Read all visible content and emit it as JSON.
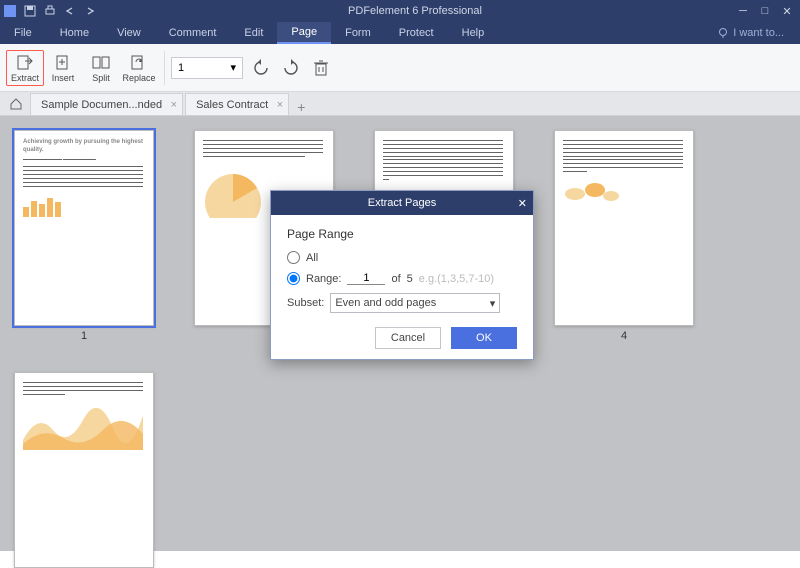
{
  "app": {
    "title": "PDFelement 6 Professional"
  },
  "menu": {
    "items": [
      "File",
      "Home",
      "View",
      "Comment",
      "Edit",
      "Page",
      "Form",
      "Protect",
      "Help"
    ],
    "active": "Page",
    "want": "I want to..."
  },
  "ribbon": {
    "tools": [
      {
        "id": "extract",
        "label": "Extract",
        "highlight": true
      },
      {
        "id": "insert",
        "label": "Insert"
      },
      {
        "id": "split",
        "label": "Split"
      },
      {
        "id": "replace",
        "label": "Replace"
      }
    ],
    "page_value": "1"
  },
  "tabs": [
    {
      "id": "doc1",
      "label": "Sample Documen...nded"
    },
    {
      "id": "doc2",
      "label": "Sales Contract"
    }
  ],
  "thumbs": {
    "count": 5,
    "visible_numbers": [
      "1",
      "4"
    ],
    "selected": 1,
    "page1_heading": "Achieving growth by pursuing the highest quality."
  },
  "dialog": {
    "title": "Extract Pages",
    "heading": "Page Range",
    "opt_all": "All",
    "opt_range": "Range:",
    "range_value": "1",
    "of_label": "of",
    "of_total": "5",
    "hint": "e.g.(1,3,5,7-10)",
    "subset_label": "Subset:",
    "subset_value": "Even and odd pages",
    "cancel": "Cancel",
    "ok": "OK"
  }
}
